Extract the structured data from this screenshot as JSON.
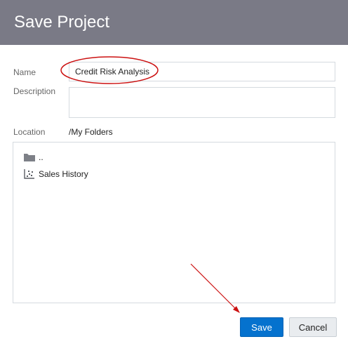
{
  "dialog": {
    "title": "Save Project"
  },
  "form": {
    "name_label": "Name",
    "name_value": "Credit Risk Analysis",
    "description_label": "Description",
    "description_value": "",
    "location_label": "Location",
    "location_value": "/My Folders"
  },
  "files": [
    {
      "label": "..",
      "icon": "folder-icon"
    },
    {
      "label": "Sales History",
      "icon": "scatter-chart-icon"
    }
  ],
  "buttons": {
    "save_label": "Save",
    "cancel_label": "Cancel"
  },
  "annotations": {
    "highlight_color": "#cc1111"
  },
  "colors": {
    "title_bar": "#7a7a86",
    "primary": "#0572ce"
  }
}
